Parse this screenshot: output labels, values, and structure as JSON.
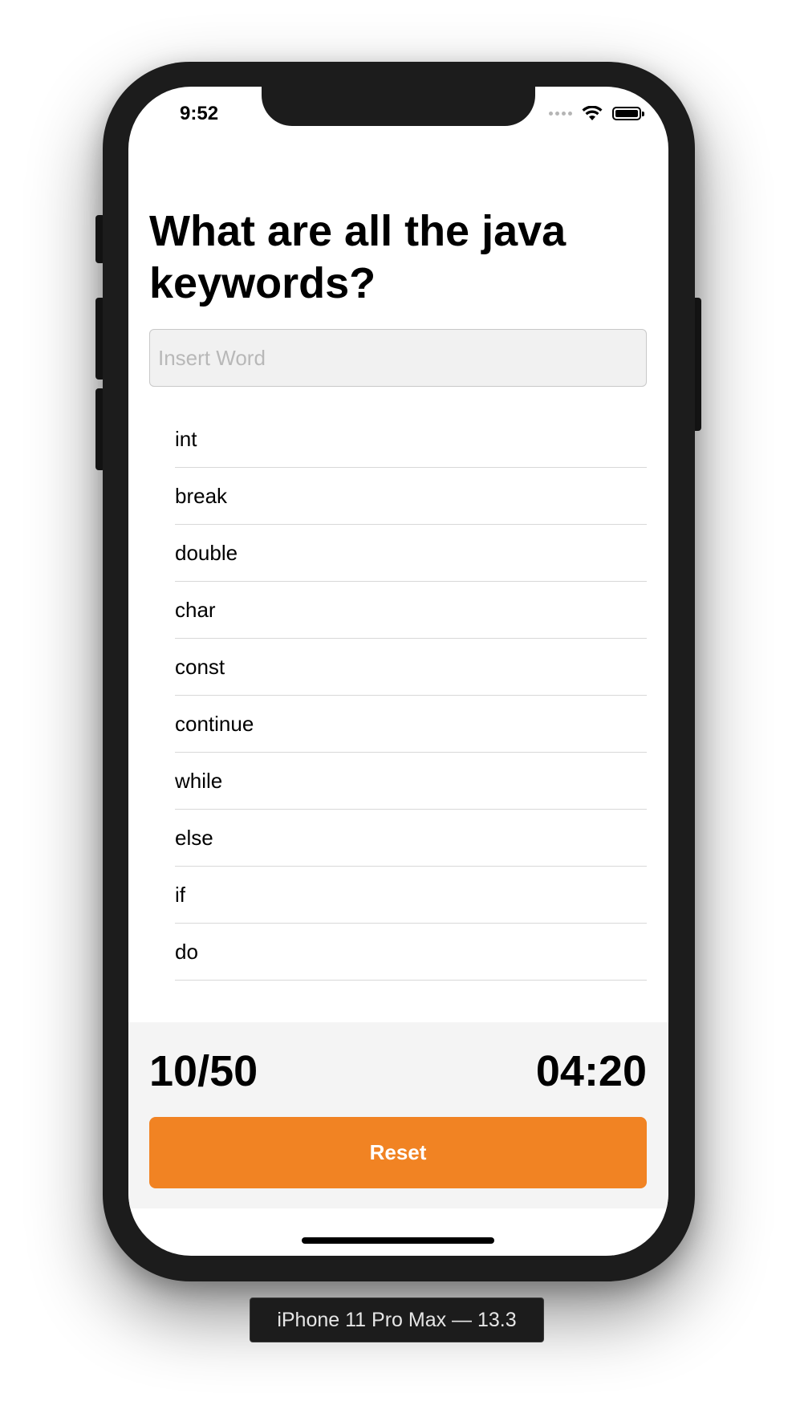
{
  "status_bar": {
    "time": "9:52",
    "signal_icon": "cellular-signal-icon",
    "wifi_icon": "wifi-icon",
    "battery_icon": "battery-icon"
  },
  "question": {
    "title": "What are all the java keywords?"
  },
  "input": {
    "placeholder": "Insert Word",
    "value": ""
  },
  "words": [
    "int",
    "break",
    "double",
    "char",
    "const",
    "continue",
    "while",
    "else",
    "if",
    "do"
  ],
  "footer": {
    "score": "10/50",
    "timer": "04:20",
    "reset_label": "Reset"
  },
  "device": {
    "label": "iPhone 11 Pro Max — 13.3"
  },
  "colors": {
    "accent": "#f18323",
    "device_frame": "#1c1c1c",
    "footer_bg": "#f4f4f4",
    "input_bg": "#f1f1f1"
  }
}
